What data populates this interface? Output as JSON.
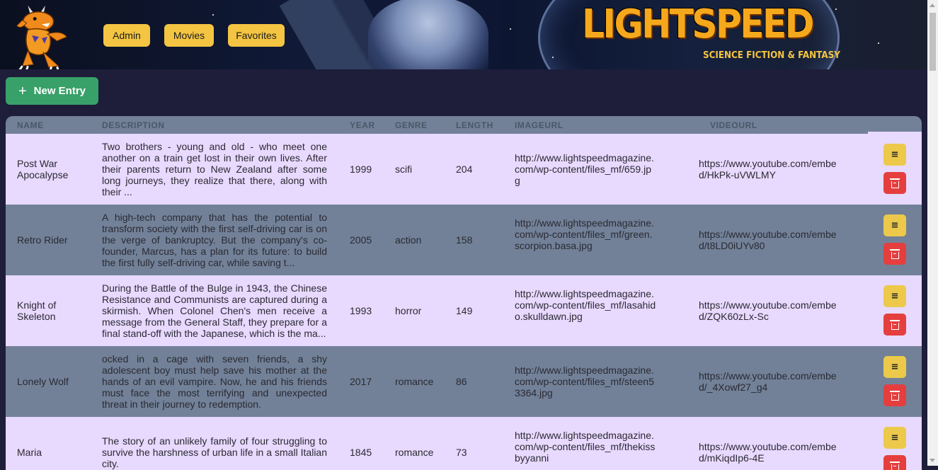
{
  "nav": {
    "admin_label": "Admin",
    "movies_label": "Movies",
    "favorites_label": "Favorites"
  },
  "banner": {
    "title": "LIGHTSPEED",
    "subtitle": "SCIENCE FICTION & FANTASY"
  },
  "toolbar": {
    "new_entry_label": "New Entry",
    "new_entry_icon": "plus-icon"
  },
  "table": {
    "headers": [
      "NAME",
      "DESCRIPTION",
      "YEAR",
      "GENRE",
      "LENGTH",
      "IMAGEURL",
      "VIDEOURL"
    ],
    "rows": [
      {
        "name": "Post War Apocalypse",
        "description": "Two brothers - young and old - who meet one another on a train get lost in their own lives. After their parents return to New Zealand after some long journeys, they realize that there, along with their ...",
        "year": "1999",
        "genre": "scifi",
        "length": "204",
        "imageurl": "http://www.lightspeedmagazine.com/wp-content/files_mf/659.jpg",
        "videourl": "https://www.youtube.com/embed/HkPk-uVWLMY"
      },
      {
        "name": "Retro Rider",
        "description": "A high-tech company that has the potential to transform society with the first self-driving car is on the verge of bankruptcy. But the company's co-founder, Marcus, has a plan for its future: to build the first fully self-driving car, while saving t...",
        "year": "2005",
        "genre": "action",
        "length": "158",
        "imageurl": "http://www.lightspeedmagazine.com/wp-content/files_mf/green.scorpion.basa.jpg",
        "videourl": "https://www.youtube.com/embed/t8LD0iUYv80"
      },
      {
        "name": "Knight of Skeleton",
        "description": "During the Battle of the Bulge in 1943, the Chinese Resistance and Communists are captured during a skirmish. When Colonel Chen's men receive a message from the General Staff, they prepare for a final stand-off with the Japanese, which is the ma...",
        "year": "1993",
        "genre": "horror",
        "length": "149",
        "imageurl": "http://www.lightspeedmagazine.com/wp-content/files_mf/lasahido.skulldawn.jpg",
        "videourl": "https://www.youtube.com/embed/ZQK60zLx-Sc"
      },
      {
        "name": "Lonely Wolf",
        "description": "ocked in a cage with seven friends, a shy adolescent boy must help save his mother at the hands of an evil vampire. Now, he and his friends must face the most terrifying and unexpected threat in their journey to redemption.",
        "year": "2017",
        "genre": "romance",
        "length": "86",
        "imageurl": "http://www.lightspeedmagazine.com/wp-content/files_mf/steen53364.jpg",
        "videourl": "https://www.youtube.com/embed/_4Xowf27_g4"
      },
      {
        "name": "Maria",
        "description": "The story of an unlikely family of four struggling to survive the harshness of urban life in a small Italian city.",
        "year": "1845",
        "genre": "romance",
        "length": "73",
        "imageurl": "http://www.lightspeedmagazine.com/wp-content/files_mf/thekissbyyanni",
        "videourl": "https://www.youtube.com/embed/mKiqdIp6-4E"
      }
    ]
  },
  "actions": {
    "edit_icon": "menu-lines-icon",
    "delete_icon": "trash-icon",
    "edit_color": "#ecc94b",
    "delete_color": "#e53e3e"
  },
  "colors": {
    "row_light": "#e8d9ff",
    "row_dark": "#728198",
    "new_entry": "#38a169",
    "nav_button": "#f4c542"
  }
}
